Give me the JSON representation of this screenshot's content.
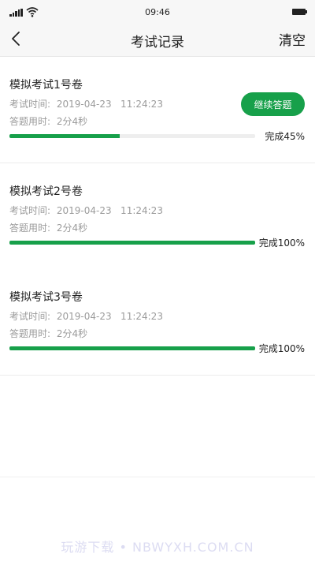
{
  "status_bar": {
    "time": "09:46"
  },
  "nav": {
    "title": "考试记录",
    "clear_label": "清空"
  },
  "records": [
    {
      "title": "模拟考试1号卷",
      "time_label": "考试时间:",
      "time_value": "2019-04-23   11:24:23",
      "duration_label": "答题用时:",
      "duration_value": "2分4秒",
      "progress": 45,
      "progress_text": "完成45%",
      "continue_label": "继续答题"
    },
    {
      "title": "模拟考试2号卷",
      "time_label": "考试时间:",
      "time_value": "2019-04-23   11:24:23",
      "duration_label": "答题用时:",
      "duration_value": "2分4秒",
      "progress": 100,
      "progress_text": "完成100%"
    },
    {
      "title": "模拟考试3号卷",
      "time_label": "考试时间:",
      "time_value": "2019-04-23   11:24:23",
      "duration_label": "答题用时:",
      "duration_value": "2分4秒",
      "progress": 100,
      "progress_text": "完成100%"
    }
  ],
  "watermark": "玩游下载 • NBWYXH.COM.CN",
  "colors": {
    "accent": "#17a04a",
    "muted_text": "#9b9b9b"
  }
}
